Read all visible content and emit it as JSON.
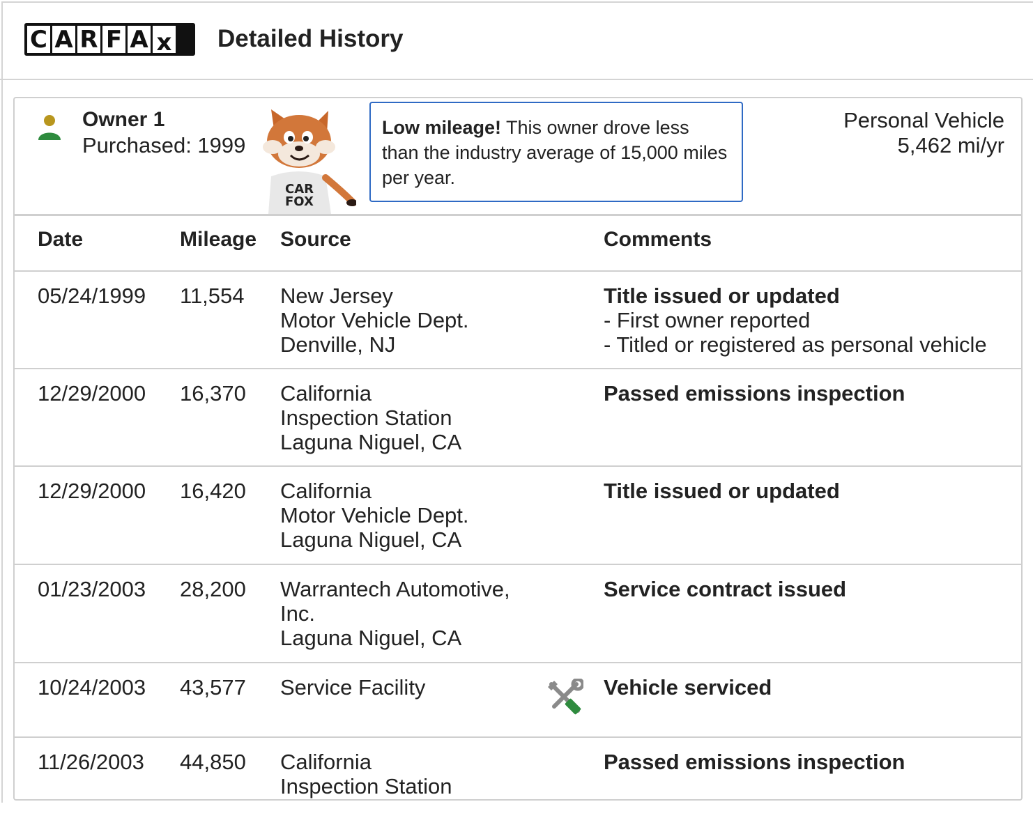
{
  "header": {
    "logo_letters": [
      "C",
      "A",
      "R",
      "F",
      "A",
      "x"
    ],
    "title": "Detailed History"
  },
  "owner": {
    "name": "Owner 1",
    "purchased": "Purchased: 1999",
    "vehicle_type": "Personal Vehicle",
    "miles_per_year": "5,462 mi/yr",
    "tip_bold": "Low mileage!",
    "tip_text": " This owner drove less than the industry average of 15,000 miles per year.",
    "mascot_shirt_text": [
      "CAR",
      "FOX"
    ]
  },
  "table": {
    "headers": {
      "date": "Date",
      "mileage": "Mileage",
      "source": "Source",
      "comments": "Comments"
    },
    "rows": [
      {
        "date": "05/24/1999",
        "mileage": "11,554",
        "source": [
          "New Jersey",
          "Motor Vehicle Dept.",
          "Denville, NJ"
        ],
        "comment": "Title issued or updated",
        "details": [
          "- First owner reported",
          "- Titled or registered as personal vehicle"
        ]
      },
      {
        "date": "12/29/2000",
        "mileage": "16,370",
        "source": [
          "California",
          "Inspection Station",
          "Laguna Niguel, CA"
        ],
        "comment": "Passed emissions inspection",
        "details": []
      },
      {
        "date": "12/29/2000",
        "mileage": "16,420",
        "source": [
          "California",
          "Motor Vehicle Dept.",
          "Laguna Niguel, CA"
        ],
        "comment": "Title issued or updated",
        "details": []
      },
      {
        "date": "01/23/2003",
        "mileage": "28,200",
        "source": [
          "Warrantech Automotive,",
          "Inc.",
          "Laguna Niguel, CA"
        ],
        "comment": "Service contract issued",
        "details": []
      },
      {
        "date": "10/24/2003",
        "mileage": "43,577",
        "source": [
          "Service Facility"
        ],
        "comment": "Vehicle serviced",
        "details": [],
        "icon": "wrench-screwdriver-icon"
      },
      {
        "date": "11/26/2003",
        "mileage": "44,850",
        "source": [
          "California",
          "Inspection Station"
        ],
        "comment": "Passed emissions inspection",
        "details": []
      }
    ]
  },
  "colors": {
    "accent_blue": "#2f6ac4",
    "person_head": "#b8961e",
    "person_body": "#2e8b3e",
    "tool_green": "#2e8b3e",
    "tool_gray": "#8a8a8a",
    "border": "#cfcfcf"
  }
}
